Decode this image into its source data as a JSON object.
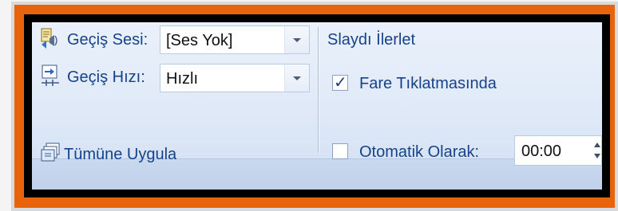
{
  "transition": {
    "sound_label": "Geçiş Sesi:",
    "sound_value": "[Ses Yok]",
    "speed_label": "Geçiş Hızı:",
    "speed_value": "Hızlı",
    "apply_all_label": "Tümüne Uygula"
  },
  "advance": {
    "group_title": "Slaydı İlerlet",
    "on_click_label": "Fare Tıklatmasında",
    "on_click_checked": true,
    "automatic_label": "Otomatik Olarak:",
    "automatic_checked": false,
    "automatic_time": "00:00"
  },
  "icons": [
    "sound-icon",
    "speed-icon",
    "apply-all-icon"
  ],
  "colors": {
    "label": "#15428b",
    "frame": "#e8640c"
  }
}
